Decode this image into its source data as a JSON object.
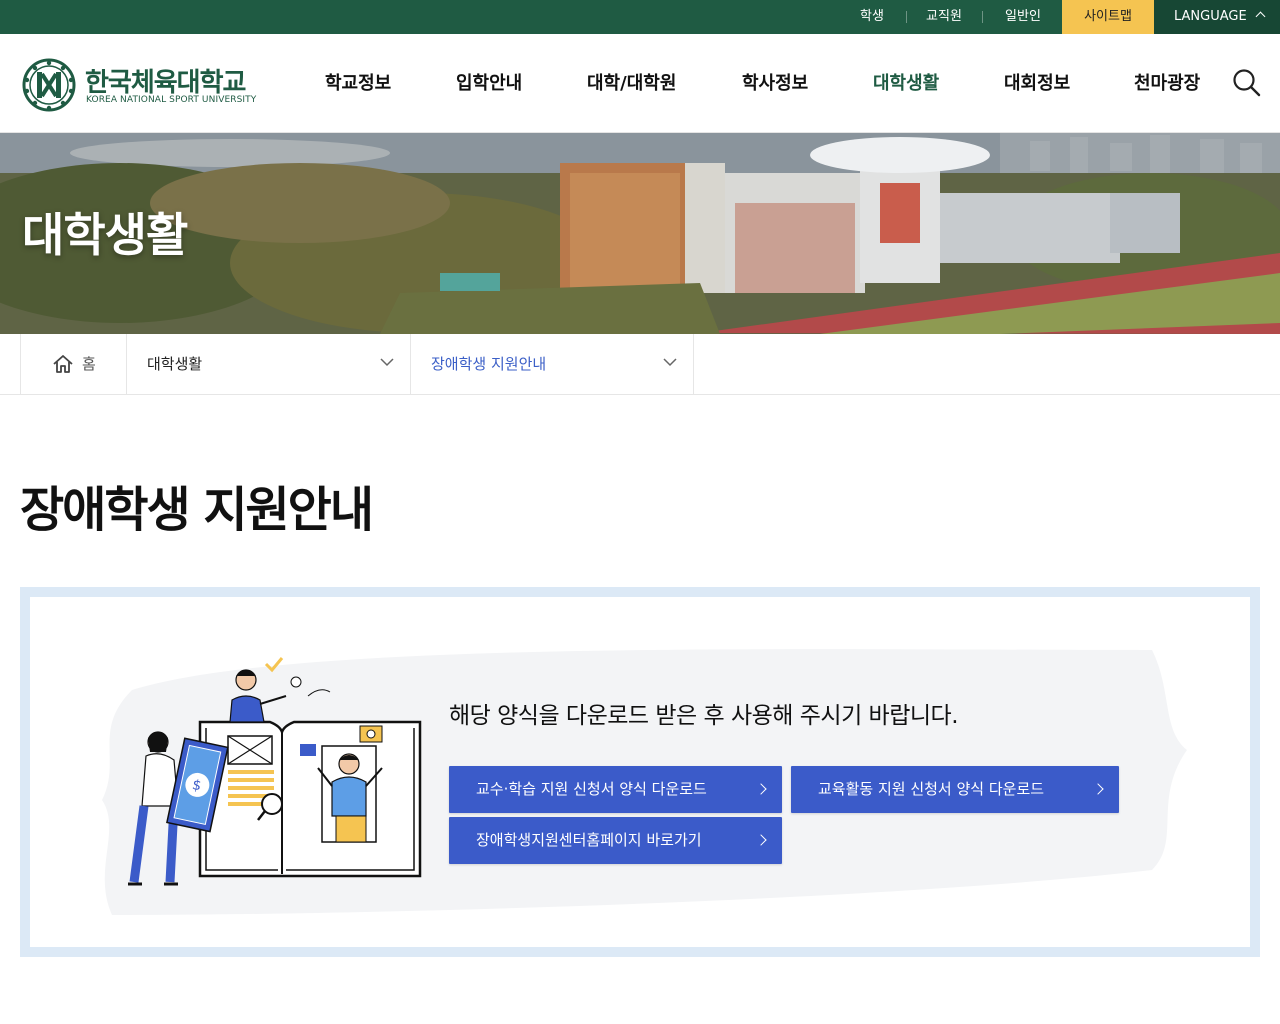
{
  "topbar": {
    "links": [
      "학생",
      "교직원",
      "일반인"
    ],
    "sitemap": "사이트맵",
    "language": "LANGUAGE"
  },
  "logo": {
    "korean": "한국체육대학교",
    "english": "KOREA NATIONAL SPORT UNIVERSITY"
  },
  "nav": {
    "items": [
      "학교정보",
      "입학안내",
      "대학/대학원",
      "학사정보",
      "대학생활",
      "대회정보",
      "천마광장"
    ],
    "active": "대학생활"
  },
  "hero": {
    "title": "대학생활"
  },
  "breadcrumb": {
    "home": "홈",
    "level1": "대학생활",
    "level2": "장애학생 지원안내"
  },
  "page": {
    "title": "장애학생 지원안내",
    "message": "해당 양식을 다운로드 받은 후 사용해 주시기 바랍니다.",
    "buttons": [
      "교수·학습 지원 신청서 양식 다운로드",
      "교육활동 지원 신청서 양식 다운로드",
      "장애학생지원센터홈페이지 바로가기"
    ]
  },
  "colors": {
    "brand_green": "#1f5b43",
    "sitemap_yellow": "#f5c451",
    "button_blue": "#3b5bc9",
    "box_border": "#dce9f6"
  }
}
